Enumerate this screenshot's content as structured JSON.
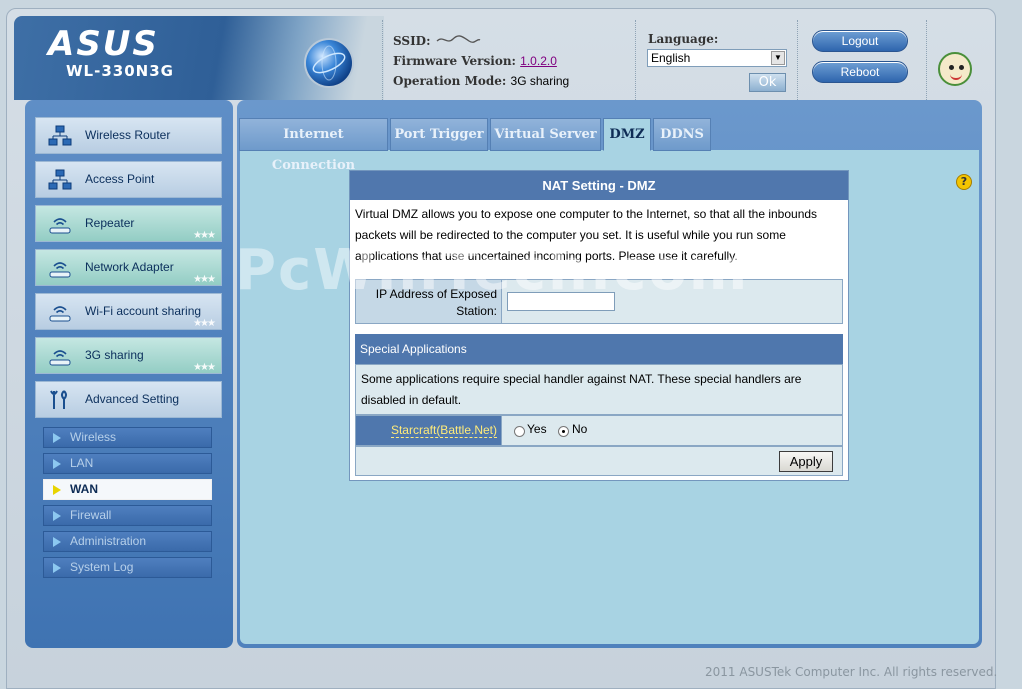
{
  "header": {
    "logo": "ASUS",
    "model": "WL-330N3G",
    "ssid_label": "SSID:",
    "firmware_label": "Firmware Version:",
    "firmware_value": "1.0.2.0",
    "opmode_label": "Operation Mode:",
    "opmode_value": "3G sharing",
    "language_label": "Language:",
    "language_value": "English",
    "ok_label": "Ok",
    "logout_label": "Logout",
    "reboot_label": "Reboot"
  },
  "sidebar": {
    "main_items": [
      {
        "label": "Wireless Router",
        "icon": "network-router-icon"
      },
      {
        "label": "Access Point",
        "icon": "access-point-icon"
      },
      {
        "label": "Repeater",
        "icon": "repeater-icon"
      },
      {
        "label": "Network Adapter",
        "icon": "network-adapter-icon"
      },
      {
        "label": "Wi-Fi account sharing",
        "icon": "wifi-sharing-icon"
      },
      {
        "label": "3G sharing",
        "icon": "3g-sharing-icon"
      },
      {
        "label": "Advanced Setting",
        "icon": "tools-icon"
      }
    ],
    "sub_items": [
      {
        "label": "Wireless"
      },
      {
        "label": "LAN"
      },
      {
        "label": "WAN"
      },
      {
        "label": "Firewall"
      },
      {
        "label": "Administration"
      },
      {
        "label": "System Log"
      }
    ]
  },
  "tabs": [
    {
      "label": "Internet Connection"
    },
    {
      "label": "Port Trigger"
    },
    {
      "label": "Virtual Server"
    },
    {
      "label": "DMZ"
    },
    {
      "label": "DDNS"
    }
  ],
  "watermark": "PcWinTech.com",
  "form": {
    "title": "NAT Setting - DMZ",
    "description": "Virtual DMZ allows you to expose one computer to the Internet, so that all the inbounds packets will be redirected to the computer you set. It is useful while you run some applications that use uncertained incoming ports. Please use it carefully.",
    "ip_label": "IP Address of Exposed Station:",
    "ip_value": "",
    "special_header": "Special Applications",
    "special_desc": "Some applications require special handler against NAT. These special handlers are disabled in default.",
    "starcraft_label": "Starcraft(Battle.Net)",
    "yes_label": "Yes",
    "no_label": "No",
    "selected": "No",
    "apply_label": "Apply"
  },
  "footer": "2011 ASUSTek Computer Inc. All rights reserved.",
  "colors": {
    "primary_blue": "#5077ad",
    "content_bg": "#a8d3e3",
    "link": "#800080"
  }
}
